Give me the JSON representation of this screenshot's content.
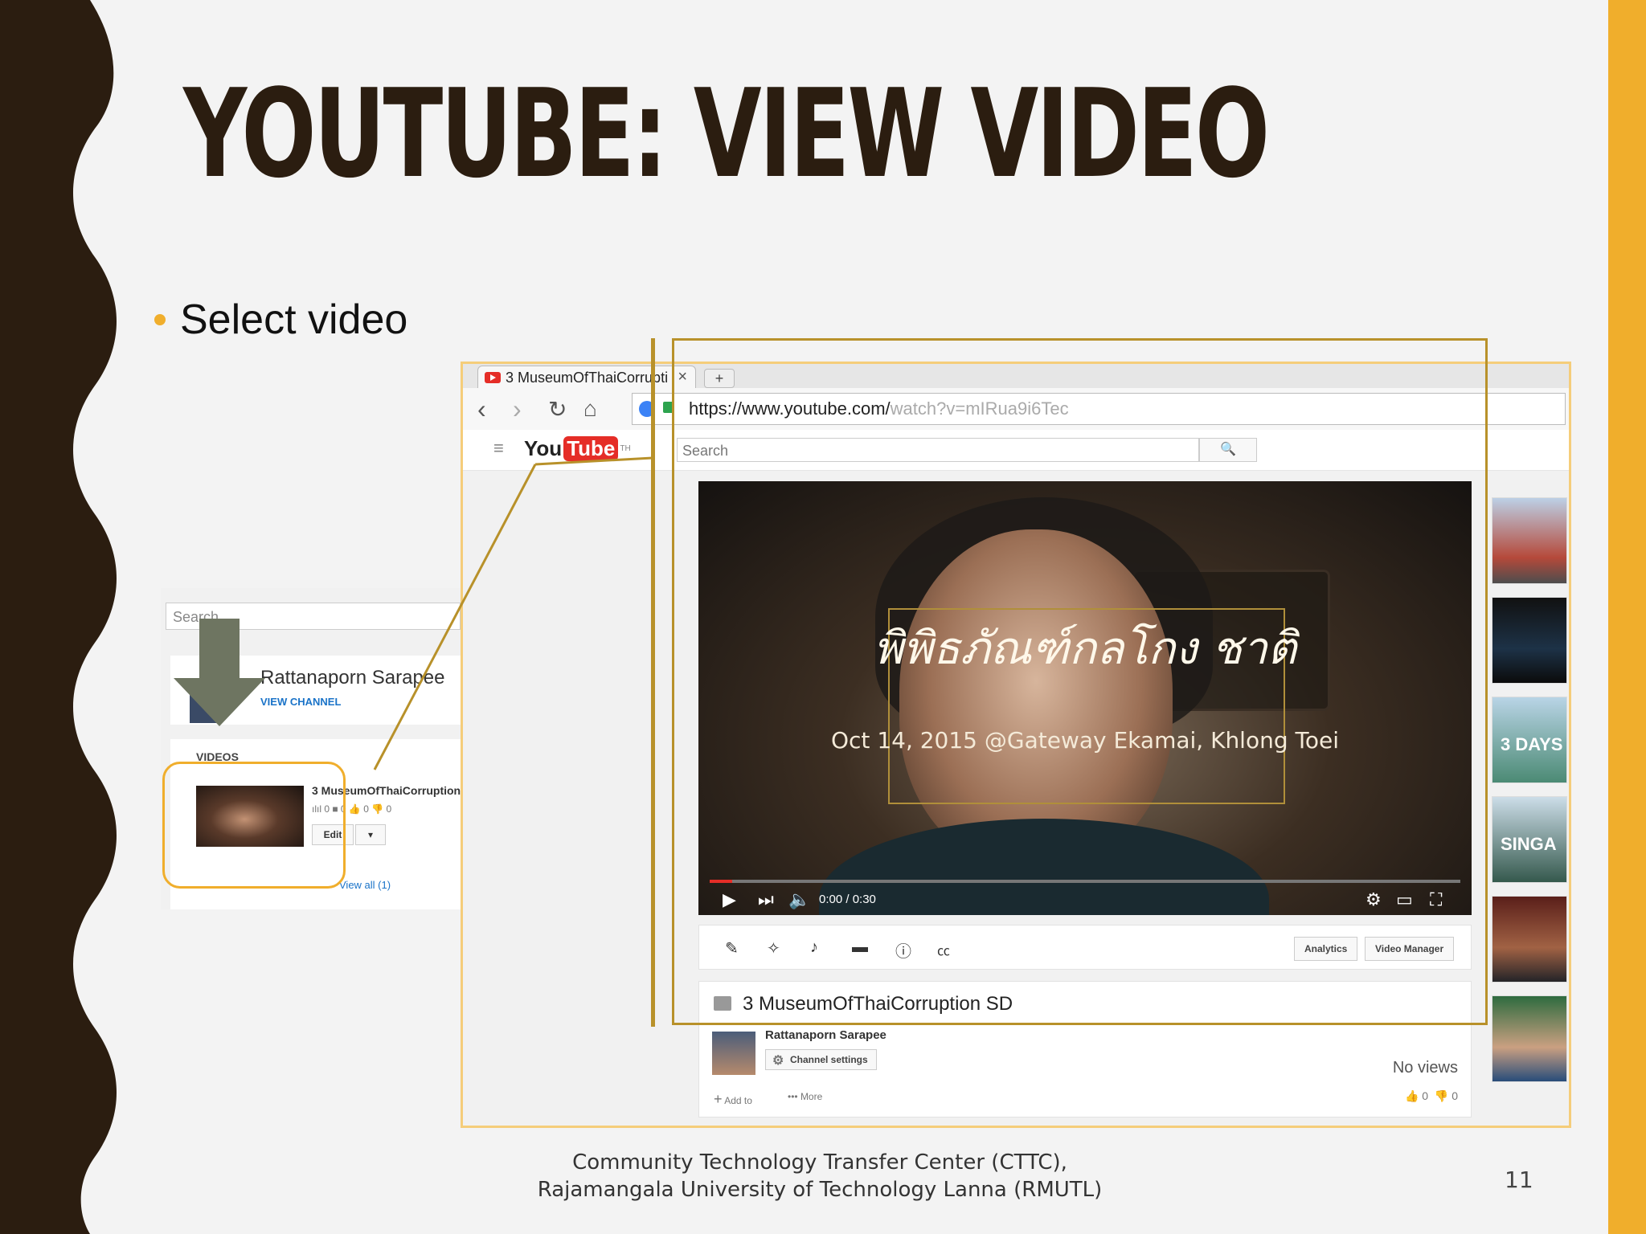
{
  "slide": {
    "title": "YOUTUBE: VIEW VIDEO",
    "bullet": "Select video",
    "footer_line1": "Community Technology Transfer Center (CTTC),",
    "footer_line2": "Rajamangala University of Technology Lanna (RMUTL)",
    "page_number": "11",
    "accent_color": "#f0ae2c",
    "dark_color": "#2b1d10"
  },
  "browser": {
    "tab_title": "3 MuseumOfThaiCorrupti",
    "tab_close": "×",
    "new_tab": "+",
    "url_host": "https://www.youtube.com/",
    "url_path": "watch?v=mIRua9i6Tec",
    "icons": [
      "back-icon",
      "forward-icon",
      "reload-icon",
      "home-icon"
    ]
  },
  "youtube": {
    "logo_you": "You",
    "logo_tube": "Tube",
    "logo_region": "TH",
    "search_placeholder": "Search",
    "search_icon": "🔍",
    "player": {
      "overlay_title": "พิพิธภัณฑ์กลโกง ชาติ",
      "overlay_date": "Oct 14, 2015 @Gateway Ekamai, Khlong Toei",
      "time": "0:00 / 0:30",
      "progress": 0.03
    },
    "actions": {
      "analytics": "Analytics",
      "video_manager": "Video Manager"
    },
    "info": {
      "video_title": "3 MuseumOfThaiCorruption SD",
      "channel_name": "Rattanaporn Sarapee",
      "channel_settings": "Channel settings",
      "views": "No views",
      "add_to": "Add to",
      "more": "••• More",
      "likes": "0",
      "dislikes": "0"
    },
    "suggested": [
      {
        "label": ""
      },
      {
        "label": ""
      },
      {
        "label": "3 DAYS"
      },
      {
        "label": "SINGA"
      },
      {
        "label": ""
      },
      {
        "label": ""
      }
    ]
  },
  "dashboard": {
    "search_placeholder": "Search",
    "channel_name": "Rattanaporn Sarapee",
    "view_channel": "VIEW CHANNEL",
    "videos_label": "VIDEOS",
    "video_title": "3 MuseumOfThaiCorruption",
    "stats": "ılıl 0   ■ 0   👍 0   👎 0",
    "edit": "Edit",
    "dropdown": "▾",
    "view_all": "View all (1)"
  }
}
